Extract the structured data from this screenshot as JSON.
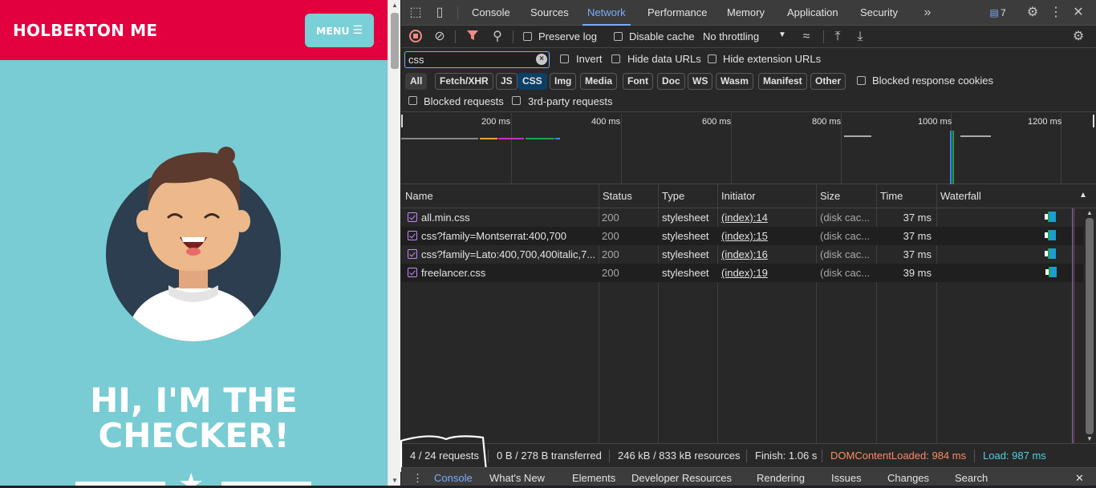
{
  "site": {
    "brand": "HOLBERTON ME",
    "menu_label": "MENU",
    "hero_line1": "HI, I'M THE",
    "hero_line2": "CHECKER!",
    "colors": {
      "nav": "#e3003f",
      "hero": "#79ccd3",
      "avatar_bg": "#2c3e50"
    }
  },
  "devtools": {
    "tabs": [
      "Console",
      "Sources",
      "Network",
      "Performance",
      "Memory",
      "Application",
      "Security"
    ],
    "active_tab": "Network",
    "more_tabs_icon": "chevrons-right-icon",
    "issues_count": "7",
    "toolbar": {
      "preserve_log": "Preserve log",
      "disable_cache": "Disable cache",
      "throttling": "No throttling"
    },
    "filter": {
      "value": "css",
      "invert": "Invert",
      "hide_data_urls": "Hide data URLs",
      "hide_extension_urls": "Hide extension URLs"
    },
    "type_filters": [
      "All",
      "Fetch/XHR",
      "JS",
      "CSS",
      "Img",
      "Media",
      "Font",
      "Doc",
      "WS",
      "Wasm",
      "Manifest",
      "Other"
    ],
    "active_type_filter": "CSS",
    "blocked_response_cookies": "Blocked response cookies",
    "blocked_requests": "Blocked requests",
    "third_party_requests": "3rd-party requests",
    "timeline_labels": [
      "200 ms",
      "400 ms",
      "600 ms",
      "800 ms",
      "1000 ms",
      "1200 ms"
    ],
    "columns": [
      "Name",
      "Status",
      "Type",
      "Initiator",
      "Size",
      "Time",
      "Waterfall"
    ],
    "requests": [
      {
        "name": "all.min.css",
        "status": "200",
        "type": "stylesheet",
        "initiator": "(index):14",
        "size": "(disk cac...",
        "time": "37 ms"
      },
      {
        "name": "css?family=Montserrat:400,700",
        "status": "200",
        "type": "stylesheet",
        "initiator": "(index):15",
        "size": "(disk cac...",
        "time": "37 ms"
      },
      {
        "name": "css?family=Lato:400,700,400italic,7...",
        "status": "200",
        "type": "stylesheet",
        "initiator": "(index):16",
        "size": "(disk cac...",
        "time": "37 ms"
      },
      {
        "name": "freelancer.css",
        "status": "200",
        "type": "stylesheet",
        "initiator": "(index):19",
        "size": "(disk cac...",
        "time": "39 ms"
      }
    ],
    "status": {
      "requests": "4 / 24 requests",
      "transferred": "0 B / 278 B transferred",
      "resources": "246 kB / 833 kB resources",
      "finish": "Finish: 1.06 s",
      "dom_content_loaded": "DOMContentLoaded: 984 ms",
      "load": "Load: 987 ms"
    },
    "drawer_tabs": [
      "Console",
      "What's New",
      "Elements",
      "Developer Resources",
      "Rendering",
      "Issues",
      "Changes",
      "Search"
    ],
    "active_drawer_tab": "Console",
    "colors": {
      "accent": "#7cacf8",
      "dcl": "#ff8a65",
      "load": "#4dd0e1",
      "css_icon": "#c58af9"
    }
  }
}
